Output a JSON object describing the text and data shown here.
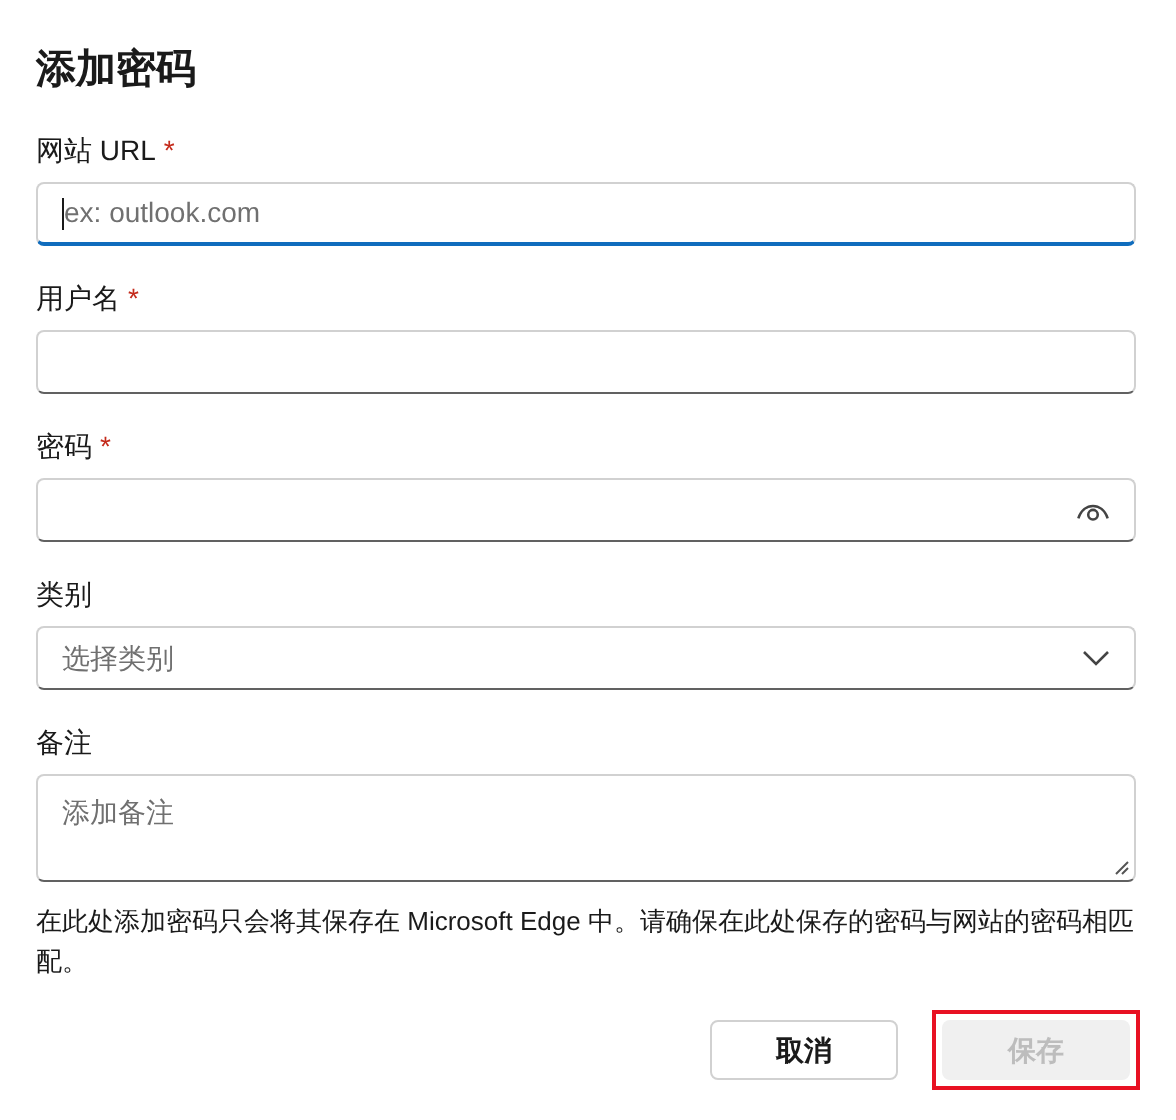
{
  "title": "添加密码",
  "fields": [
    {
      "kind": "text",
      "label": "网站 URL",
      "required_mark": "*",
      "placeholder": "ex: outlook.com",
      "focused": true
    },
    {
      "kind": "text",
      "label": "用户名",
      "required_mark": "*",
      "focused": false
    },
    {
      "kind": "password",
      "label": "密码",
      "required_mark": "*",
      "focused": false
    },
    {
      "kind": "select",
      "label": "类别",
      "placeholder": "选择类别",
      "focused": false
    },
    {
      "kind": "textarea",
      "label": "备注",
      "placeholder": "添加备注",
      "focused": false
    }
  ],
  "notice": "在此处添加密码只会将其保存在 Microsoft Edge 中。请确保在此处保存的密码与网站的密码相匹配。",
  "buttons": [
    {
      "kind": "secondary",
      "label": "取消",
      "disabled": false,
      "highlighted": false
    },
    {
      "kind": "primary",
      "label": "保存",
      "disabled": true,
      "highlighted": true
    }
  ]
}
